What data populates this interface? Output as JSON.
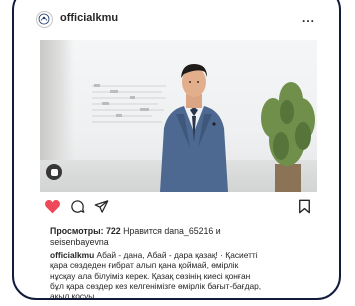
{
  "post": {
    "username": "officialkmu",
    "more_label": "...",
    "views_label": "Просмотры: 722",
    "likes_text": "Нравится dana_65216 и",
    "likes_text_2": "seisenbayevna",
    "caption_user": "officialkmu",
    "caption_line1": " Абай - дана, Абай - дара қазақ! · Қасиетті",
    "caption_line2": "қара сөздеден ғибрат алып қана қоймай, өмірлік",
    "caption_line3": "нұсқау ала білуіміз керек. Қазақ сөзінің киесі қонған",
    "caption_line4": "бұл қара сөздер кез келгенімізге өмірлік бағыт-бағдар,",
    "caption_line5": "ақыл қосуы."
  },
  "colors": {
    "like": "#ed4956",
    "border": "#101c3a"
  },
  "icons": [
    "logo-icon",
    "more-icon",
    "video-indicator-icon",
    "heart-icon",
    "comment-icon",
    "share-icon",
    "bookmark-icon"
  ]
}
